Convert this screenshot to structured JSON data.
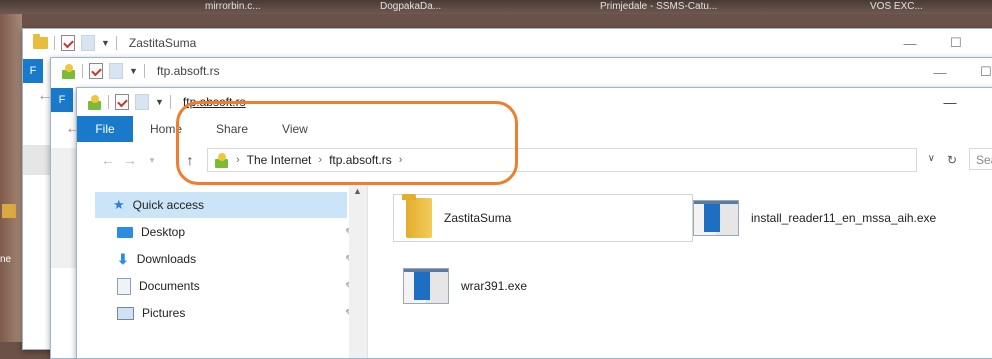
{
  "desktop": {
    "taskbar_items": [
      "mirrorbin.c...",
      "DogpakaDa...",
      "Primjedale - SSMS-Catu...",
      "VOS EXC..."
    ],
    "side_label": "ne"
  },
  "windows": {
    "back": {
      "title": "ZastitaSuma",
      "file_tab": "F",
      "minimize": "—",
      "maximize": "☐",
      "close": "✕"
    },
    "middle": {
      "title": "ftp.absoft.rs",
      "file_tab": "F",
      "minimize": "—",
      "maximize": "☐"
    },
    "front": {
      "title": "ftp.absoft.rs",
      "minimize": "—",
      "ribbon_tabs": {
        "file": "File",
        "home": "Home",
        "share": "Share",
        "view": "View"
      },
      "address": {
        "segments": [
          "The Internet",
          "ftp.absoft.rs"
        ],
        "search_placeholder": "Search"
      },
      "nav_pane": {
        "quick_access": "Quick access",
        "items": [
          "Desktop",
          "Downloads",
          "Documents",
          "Pictures"
        ]
      },
      "files": [
        {
          "name": "ZastitaSuma",
          "type": "folder"
        },
        {
          "name": "install_reader11_en_mssa_aih.exe",
          "type": "exe"
        },
        {
          "name": "wrar391.exe",
          "type": "exe"
        }
      ]
    }
  },
  "colors": {
    "accent": "#1979ca",
    "highlight": "#ef7d2b",
    "selection": "#cce4f7"
  }
}
